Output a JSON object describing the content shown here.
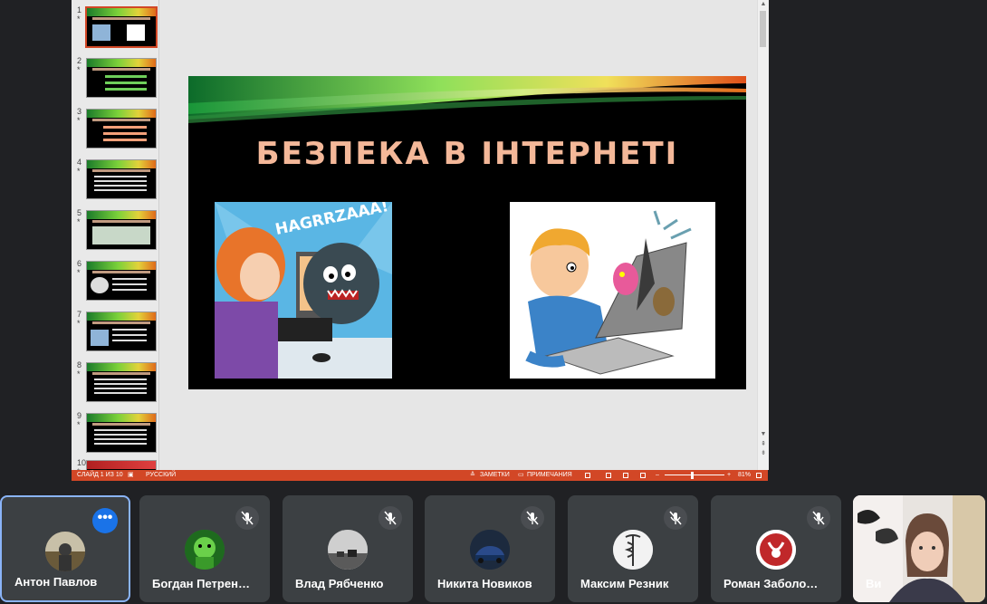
{
  "presentation": {
    "slide_title": "БЕЗПЕКА В ІНТЕРНЕТІ",
    "left_image_text": "HAGRRZAAA!",
    "thumbnails": [
      {
        "num": "1",
        "star": "*"
      },
      {
        "num": "2",
        "star": "*"
      },
      {
        "num": "3",
        "star": "*"
      },
      {
        "num": "4",
        "star": "*"
      },
      {
        "num": "5",
        "star": "*"
      },
      {
        "num": "6",
        "star": "*"
      },
      {
        "num": "7",
        "star": "*"
      },
      {
        "num": "8",
        "star": "*"
      },
      {
        "num": "9",
        "star": "*"
      },
      {
        "num": "10",
        "star": "*"
      }
    ],
    "status": {
      "slide_info": "СЛАЙД 1 ИЗ 10",
      "language": "РУССКИЙ",
      "notes": "ЗАМЕТКИ",
      "comments": "ПРИМЕЧАНИЯ",
      "zoom": "81%"
    },
    "accent_color": "#d24726"
  },
  "participants": [
    {
      "name": "Антон Павлов",
      "active": true,
      "icon": "more-options-icon"
    },
    {
      "name": "Богдан Петрен…",
      "icon": "mic-off-icon"
    },
    {
      "name": "Влад Рябченко",
      "icon": "mic-off-icon"
    },
    {
      "name": "Никита Новиков",
      "icon": "mic-off-icon"
    },
    {
      "name": "Максим Резник",
      "icon": "mic-off-icon"
    },
    {
      "name": "Роман Заболо…",
      "icon": "mic-off-icon"
    },
    {
      "name": "Ви",
      "icon": "camera-video"
    }
  ]
}
